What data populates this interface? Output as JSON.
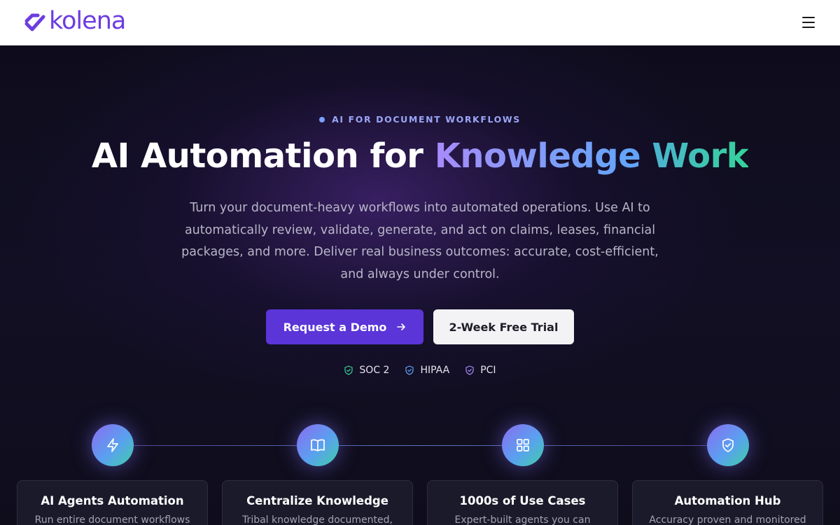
{
  "header": {
    "logo_text": "kolena",
    "menu_icon": "hamburger-menu-icon"
  },
  "hero": {
    "eyebrow": "AI FOR DOCUMENT WORKFLOWS",
    "headline_plain": "AI Automation for ",
    "headline_accent_1": "Knowledge",
    "headline_accent_2": " Work",
    "subtitle": "Turn your document-heavy workflows into automated operations. Use AI to automatically review, validate, generate, and act on claims, leases, financial packages, and more. Deliver real business outcomes: accurate, cost-efficient, and always under control.",
    "primary_cta": "Request a Demo",
    "secondary_cta": "2-Week Free Trial",
    "compliance_badges": [
      {
        "label": "SOC 2",
        "color": "#34d399",
        "icon": "shield-check-icon"
      },
      {
        "label": "HIPAA",
        "color": "#60a5fa",
        "icon": "shield-check-icon"
      },
      {
        "label": "PCI",
        "color": "#a78bfa",
        "icon": "shield-check-icon"
      }
    ]
  },
  "features": [
    {
      "title": "AI Agents Automation",
      "desc": "Run entire document workflows",
      "icon": "lightning-icon"
    },
    {
      "title": "Centralize Knowledge",
      "desc": "Tribal knowledge documented,",
      "icon": "open-book-icon"
    },
    {
      "title": "1000s of Use Cases",
      "desc": "Expert-built agents you can",
      "icon": "grid-icon"
    },
    {
      "title": "Automation Hub",
      "desc": "Accuracy proven and monitored",
      "icon": "shield-check-icon"
    }
  ],
  "colors": {
    "brand": "#6d3ce0",
    "primary_button": "#5b35d8",
    "hero_background": "#0e0c1c"
  }
}
